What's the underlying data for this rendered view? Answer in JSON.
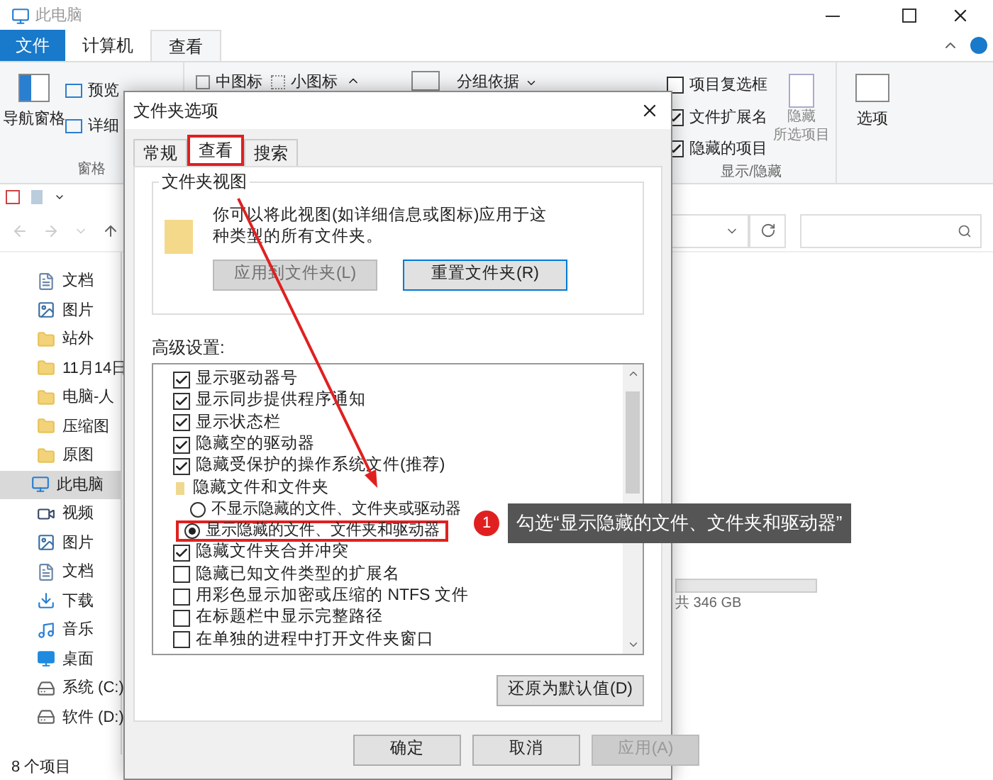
{
  "window": {
    "title": "此电脑"
  },
  "ribbon_tabs": [
    {
      "label": "文件",
      "kind": "file",
      "selected": false
    },
    {
      "label": "计算机",
      "kind": "tab",
      "selected": false
    },
    {
      "label": "查看",
      "kind": "tab",
      "selected": true
    }
  ],
  "ribbon": {
    "nav_pane": "导航窗格",
    "preview_pane": "预览",
    "details_pane": "详细",
    "pane_group": "窗格",
    "medium_icons": "中图标",
    "small_icons": "小图标",
    "group_by": "分组依据",
    "checks": [
      {
        "label": "项目复选框",
        "checked": false
      },
      {
        "label": "文件扩展名",
        "checked": true
      },
      {
        "label": "隐藏的项目",
        "checked": true
      }
    ],
    "hide_selected": [
      "隐藏",
      "所选项目"
    ],
    "show_hide_group": "显示/隐藏",
    "options": "选项"
  },
  "nav_items": [
    {
      "label": "文档",
      "kind": "doc",
      "selected": false
    },
    {
      "label": "图片",
      "kind": "pic",
      "selected": false
    },
    {
      "label": "站外",
      "kind": "folder",
      "selected": false
    },
    {
      "label": "11月14日",
      "kind": "folder",
      "selected": false
    },
    {
      "label": "电脑-人",
      "kind": "folder",
      "selected": false
    },
    {
      "label": "压缩图",
      "kind": "folder",
      "selected": false
    },
    {
      "label": "原图",
      "kind": "folder",
      "selected": false
    },
    {
      "label": "此电脑",
      "kind": "pc",
      "selected": true
    },
    {
      "label": "视频",
      "kind": "video",
      "selected": false
    },
    {
      "label": "图片",
      "kind": "pic",
      "selected": false
    },
    {
      "label": "文档",
      "kind": "doc",
      "selected": false
    },
    {
      "label": "下载",
      "kind": "download",
      "selected": false
    },
    {
      "label": "音乐",
      "kind": "music",
      "selected": false
    },
    {
      "label": "桌面",
      "kind": "desktop",
      "selected": false
    },
    {
      "label": "系统 (C:)",
      "kind": "drive",
      "selected": false
    },
    {
      "label": "软件 (D:)",
      "kind": "drive",
      "selected": false
    }
  ],
  "drive_info": "共 346 GB",
  "status_bar": "8 个项目",
  "dialog": {
    "title": "文件夹选项",
    "tabs": [
      {
        "label": "常规",
        "selected": false,
        "highlighted": false
      },
      {
        "label": "查看",
        "selected": true,
        "highlighted": true
      },
      {
        "label": "搜索",
        "selected": false,
        "highlighted": false
      }
    ],
    "folder_views": {
      "title": "文件夹视图",
      "description": "你可以将此视图(如详细信息或图标)应用于这种类型的所有文件夹。",
      "apply_button": {
        "label": "应用到文件夹(L)",
        "disabled": true
      },
      "reset_button": {
        "label": "重置文件夹(R)",
        "disabled": false
      }
    },
    "advanced_label": "高级设置:",
    "settings": [
      {
        "kind": "checkbox",
        "label": "显示驱动器号",
        "checked": true,
        "highlighted": false
      },
      {
        "kind": "checkbox",
        "label": "显示同步提供程序通知",
        "checked": true,
        "highlighted": false
      },
      {
        "kind": "checkbox",
        "label": "显示状态栏",
        "checked": true,
        "highlighted": false
      },
      {
        "kind": "checkbox",
        "label": "隐藏空的驱动器",
        "checked": true,
        "highlighted": false
      },
      {
        "kind": "checkbox",
        "label": "隐藏受保护的操作系统文件(推荐)",
        "checked": true,
        "highlighted": false
      },
      {
        "kind": "folder",
        "label": "隐藏文件和文件夹",
        "highlighted": false
      },
      {
        "kind": "radio",
        "label": "不显示隐藏的文件、文件夹或驱动器",
        "selected": false,
        "highlighted": false
      },
      {
        "kind": "radio",
        "label": "显示隐藏的文件、文件夹和驱动器",
        "selected": true,
        "highlighted": true
      },
      {
        "kind": "checkbox",
        "label": "隐藏文件夹合并冲突",
        "checked": true,
        "highlighted": false
      },
      {
        "kind": "checkbox",
        "label": "隐藏已知文件类型的扩展名",
        "checked": false,
        "highlighted": false
      },
      {
        "kind": "checkbox",
        "label": "用彩色显示加密或压缩的 NTFS 文件",
        "checked": false,
        "highlighted": false
      },
      {
        "kind": "checkbox",
        "label": "在标题栏中显示完整路径",
        "checked": false,
        "highlighted": false
      },
      {
        "kind": "checkbox",
        "label": "在单独的进程中打开文件夹窗口",
        "checked": false,
        "highlighted": false
      }
    ],
    "restore_button": "还原为默认值(D)",
    "buttons": [
      {
        "label": "确定",
        "disabled": false
      },
      {
        "label": "取消",
        "disabled": false
      },
      {
        "label": "应用(A)",
        "disabled": true
      }
    ]
  },
  "callout": {
    "badge": "1",
    "text": "勾选“显示隐藏的文件、文件夹和驱动器”"
  }
}
